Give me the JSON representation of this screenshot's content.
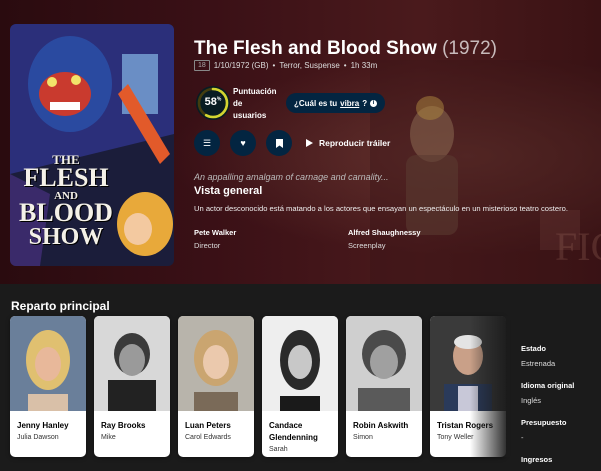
{
  "movie": {
    "title": "The Flesh and Blood Show",
    "year": "(1972)",
    "certification": "18",
    "release": "1/10/1972 (GB)",
    "genres": "Terror, Suspense",
    "runtime": "1h 33m",
    "poster_text": [
      "THE",
      "FLESH",
      "AND",
      "BLOOD",
      "SHOW"
    ]
  },
  "score": {
    "value": "58",
    "unit": "%",
    "percent": 58,
    "label_line1": "Puntuación",
    "label_line2": "de",
    "label_line3": "usuarios",
    "ring_color": "#d2d531"
  },
  "vibe": {
    "prefix": "¿Cuál es tu ",
    "link": "vibra",
    "suffix": "?"
  },
  "actions": {
    "list_icon": "list-icon",
    "favorite_icon": "heart-icon",
    "watchlist_icon": "bookmark-icon",
    "trailer_label": "Reproducir tráiler"
  },
  "tagline": "An appalling amalgam of carnage and carnality...",
  "overview": {
    "heading": "Vista general",
    "text": "Un actor desconocido está matando a los actores que ensayan un espectáculo en un misterioso teatro costero."
  },
  "crew": [
    {
      "name": "Pete Walker",
      "job": "Director"
    },
    {
      "name": "Alfred Shaughnessy",
      "job": "Screenplay"
    }
  ],
  "cast_section": {
    "title": "Reparto principal",
    "members": [
      {
        "name": "Jenny Hanley",
        "character": "Julia Dawson"
      },
      {
        "name": "Ray Brooks",
        "character": "Mike"
      },
      {
        "name": "Luan Peters",
        "character": "Carol Edwards"
      },
      {
        "name": "Candace Glendenning",
        "character": "Sarah"
      },
      {
        "name": "Robin Askwith",
        "character": "Simon"
      },
      {
        "name": "Tristan Rogers",
        "character": "Tony Weller"
      }
    ]
  },
  "facts": [
    {
      "key": "Estado",
      "value": "Estrenada"
    },
    {
      "key": "Idioma original",
      "value": "Inglés"
    },
    {
      "key": "Presupuesto",
      "value": "-"
    },
    {
      "key": "Ingresos",
      "value": ""
    }
  ]
}
